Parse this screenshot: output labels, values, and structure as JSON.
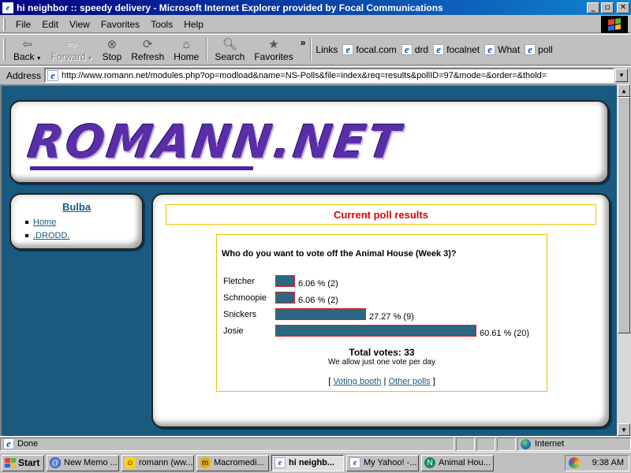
{
  "window": {
    "title": "hi neighbor :: speedy delivery - Microsoft Internet Explorer provided by Focal Communications",
    "controls": {
      "minimize": "_",
      "maximize": "▫",
      "close": "✕"
    }
  },
  "menu": [
    "File",
    "Edit",
    "View",
    "Favorites",
    "Tools",
    "Help"
  ],
  "toolbar": {
    "back": "Back",
    "forward": "Forward",
    "stop": "Stop",
    "refresh": "Refresh",
    "home": "Home",
    "search": "Search",
    "favorites": "Favorites",
    "links_label": "Links",
    "links": [
      "focal.com",
      "drd",
      "focalnet",
      "What",
      "poll"
    ]
  },
  "address": {
    "label": "Address",
    "url": "http://www.romann.net/modules.php?op=modload&name=NS-Polls&file=index&req=results&pollID=97&mode=&order=&thold="
  },
  "site": {
    "logo_text": "ROMANN.NET"
  },
  "sidebar": {
    "title": "Bulba",
    "items": [
      "Home",
      ".DRODD."
    ]
  },
  "poll": {
    "heading": "Current poll results",
    "question": "Who do you want to vote off the Animal House (Week 3)?",
    "results": [
      {
        "name": "Fletcher",
        "label": "6.06 % (2)",
        "percent": 6.06
      },
      {
        "name": "Schmoopie",
        "label": "6.06 % (2)",
        "percent": 6.06
      },
      {
        "name": "Snickers",
        "label": "27.27 % (9)",
        "percent": 27.27
      },
      {
        "name": "Josie",
        "label": "60.61 % (20)",
        "percent": 60.61
      }
    ],
    "total": "Total votes: 33",
    "note": "We allow just one vote per day",
    "links": {
      "open": "[",
      "voting_booth": "Voting booth",
      "sep": "|",
      "other_polls": "Other polls",
      "close": "]"
    }
  },
  "status": {
    "text": "Done",
    "zone": "Internet"
  },
  "taskbar": {
    "start": "Start",
    "tasks": [
      {
        "label": "New Memo ...",
        "icon": "mail-icon",
        "active": false
      },
      {
        "label": "romann (ww...",
        "icon": "chat-icon",
        "active": false
      },
      {
        "label": "Macromedi...",
        "icon": "macromedia-icon",
        "active": false
      },
      {
        "label": "hi neighb...",
        "icon": "ie-icon",
        "active": true
      },
      {
        "label": "My Yahoo! -...",
        "icon": "ie-icon",
        "active": false
      },
      {
        "label": "Animal Hou...",
        "icon": "netscape-icon",
        "active": false
      }
    ],
    "clock": "9:38 AM"
  },
  "colors": {
    "page_bg": "#1a5a80",
    "poll_bar": "#2d6680",
    "poll_bar_border": "#e02020",
    "heading_red": "#e00000",
    "box_gold": "#f0c300",
    "logo_purple": "#5a2ea8"
  }
}
